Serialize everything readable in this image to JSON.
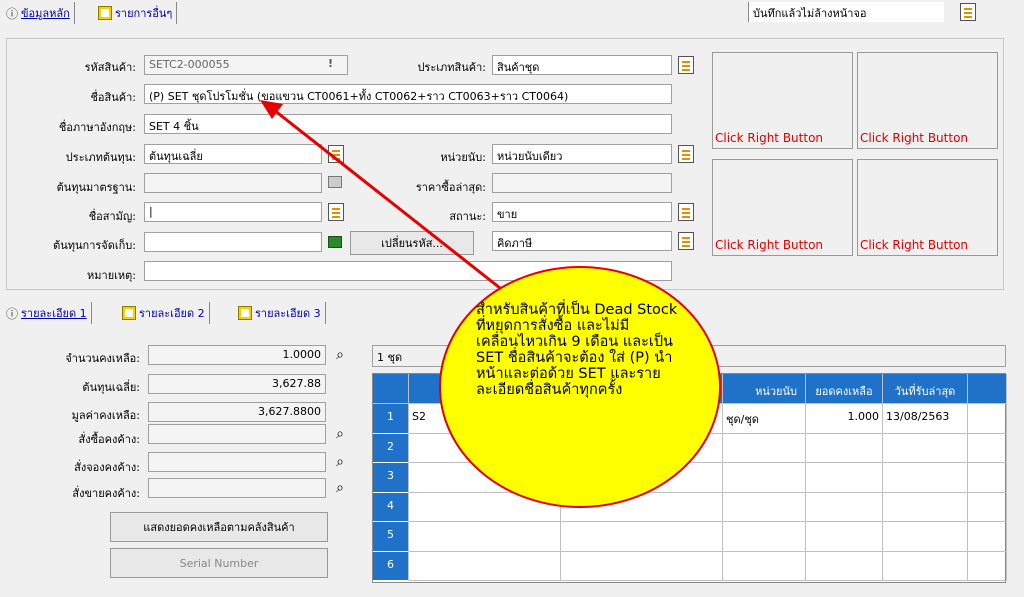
{
  "tabs_top": [
    {
      "label": "ข้อมูลหลัก"
    },
    {
      "label": "รายการอื่นๆ"
    }
  ],
  "save_mode": "บันทึกแล้วไม่ล้างหน้าจอ",
  "form": {
    "product_code_label": "รหัสสินค้า:",
    "product_code_value": "SETC2-000055",
    "product_type_label": "ประเภทสินค้า:",
    "product_type_value": "สินค้าชุด",
    "product_name_label": "ชื่อสินค้า:",
    "product_name_value": "(P) SET ชุดโปรโมชั่น (ขอแขวน CT0061+ทั้ง CT0062+ราว CT0063+ราว CT0064)",
    "english_name_label": "ชื่อภาษาอังกฤษ:",
    "english_name_value": "SET 4 ชิ้น",
    "cost_type_label": "ประเภทต้นทุน:",
    "cost_type_value": "ต้นทุนเฉลี่ย",
    "unit_label": "หน่วยนับ:",
    "unit_value": "หน่วยนับเดียว",
    "std_cost_label": "ต้นทุนมาตรฐาน:",
    "last_price_label": "ราคาซื้อล่าสุด:",
    "common_name_label": "ชื่อสามัญ:",
    "common_name_value": "|",
    "status_label": "สถานะ:",
    "status_value": "ขาย",
    "storage_cost_label": "ต้นทุนการจัดเก็บ:",
    "change_code_button": "เปลี่ยนรหัส...",
    "tax_value": "คิดภาษี",
    "note_label": "หมายเหตุ:"
  },
  "image_slots": [
    "Click Right Button",
    "Click Right Button",
    "Click Right Button",
    "Click Right Button"
  ],
  "tabs_detail": [
    {
      "label": "รายละเอียด 1"
    },
    {
      "label": "รายละเอียด 2"
    },
    {
      "label": "รายละเอียด 3"
    }
  ],
  "detail": {
    "remaining_qty_label": "จำนวนคงเหลือ:",
    "remaining_qty_value": "1.0000",
    "avg_cost_label": "ต้นทุนเฉลี่ย:",
    "avg_cost_value": "3,627.88",
    "remaining_value_label": "มูลค่าคงเหลือ:",
    "remaining_value_value": "3,627.8800",
    "pending_po_label": "สั่งซื้อคงค้าง:",
    "pending_reserve_label": "สั่งจองคงค้าง:",
    "pending_so_label": "สั่งขายคงค้าง:",
    "show_by_warehouse_button": "แสดงยอดคงเหลือตามคลังสินค้า",
    "serial_button": "Serial Number"
  },
  "grid": {
    "set_label": "1 ชุด",
    "headers": [
      "หน่วยนับ",
      "ยอดคงเหลือ",
      "วันที่รับล่าสุด"
    ],
    "rows": [
      {
        "num": "1",
        "code": "S2",
        "unit": "ชุด/ชุด",
        "qty": "1.000",
        "date": "13/08/2563"
      },
      {
        "num": "2",
        "code": "",
        "unit": "",
        "qty": "",
        "date": ""
      },
      {
        "num": "3",
        "code": "",
        "unit": "",
        "qty": "",
        "date": ""
      },
      {
        "num": "4",
        "code": "",
        "unit": "",
        "qty": "",
        "date": ""
      },
      {
        "num": "5",
        "code": "",
        "unit": "",
        "qty": "",
        "date": ""
      },
      {
        "num": "6",
        "code": "",
        "unit": "",
        "qty": "",
        "date": ""
      }
    ]
  },
  "callout": {
    "text": "สำหรับสินค้าที่เป็น Dead Stock ที่หยุดการสั่งซื้อ และไม่มีเคลื่อนไหวเกิน 9 เดือน และเป็น SET ชื่อสินค้าจะต้อง ใส่ (P) นำหน้าและต่อด้วย SET และรายละเอียดชื่อสินค้าทุกครั้ง",
    "fill": "#ffff00",
    "stroke": "#e60000"
  }
}
